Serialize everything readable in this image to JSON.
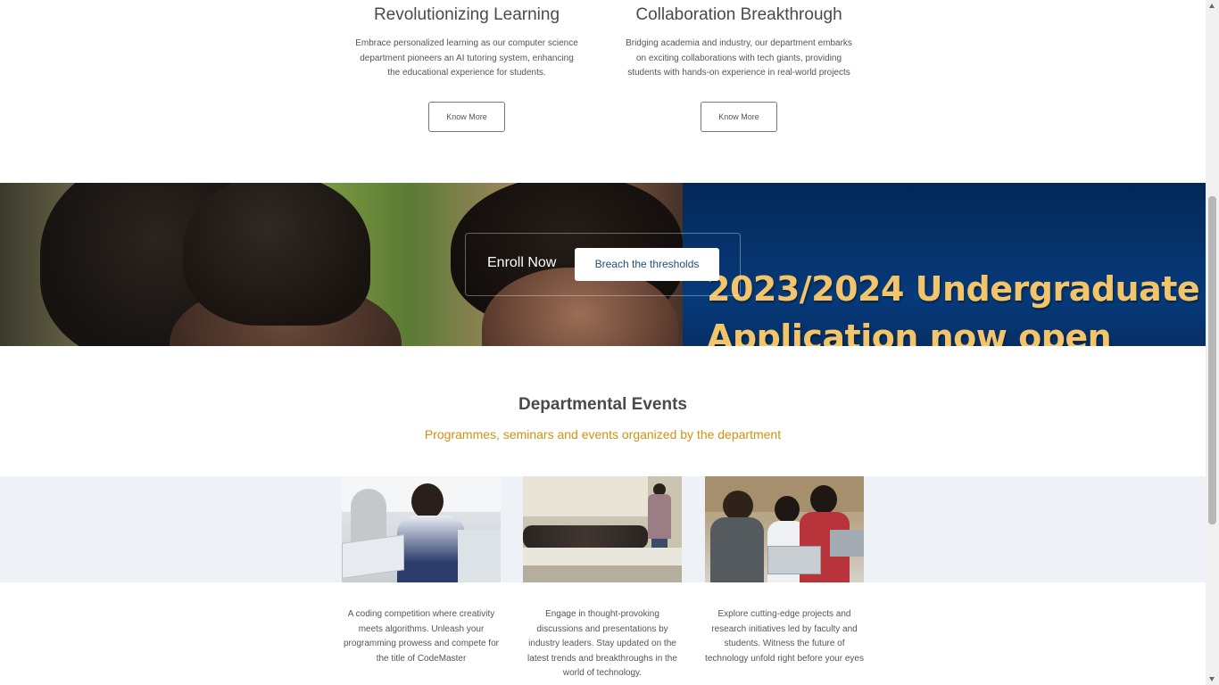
{
  "news": [
    {
      "title": "Revolutionizing Learning",
      "text": "Embrace personalized learning as our computer science department pioneers an AI tutoring system, enhancing the educational experience for students.",
      "button": "Know More"
    },
    {
      "title": "Collaboration Breakthrough",
      "text": "Bridging academia and industry, our department embarks on exciting collaborations with tech giants, providing students with hands-on experience in real-world projects",
      "button": "Know More"
    }
  ],
  "banner": {
    "headline_line1": "2023/2024 Undergraduate",
    "headline_line2": "Application now open",
    "enroll_label": "Enroll Now",
    "enroll_button": "Breach the thresholds"
  },
  "events": {
    "title": "Departmental Events",
    "subtitle": "Programmes, seminars and events organized by the department",
    "items": [
      {
        "text": "A coding competition where creativity meets algorithms. Unleash your programming prowess and compete for the title of CodeMaster"
      },
      {
        "text": "Engage in thought-provoking discussions and presentations by industry leaders. Stay updated on the latest trends and breakthroughs in the world of technology."
      },
      {
        "text": "Explore cutting-edge projects and research initiatives led by faculty and students. Witness the future of technology unfold right before your eyes"
      }
    ]
  },
  "colors": {
    "accent_subtitle": "#d49012",
    "banner_navy": "#042a63",
    "banner_headline": "#f2c56b",
    "enroll_button_text": "#1e4f7a"
  }
}
